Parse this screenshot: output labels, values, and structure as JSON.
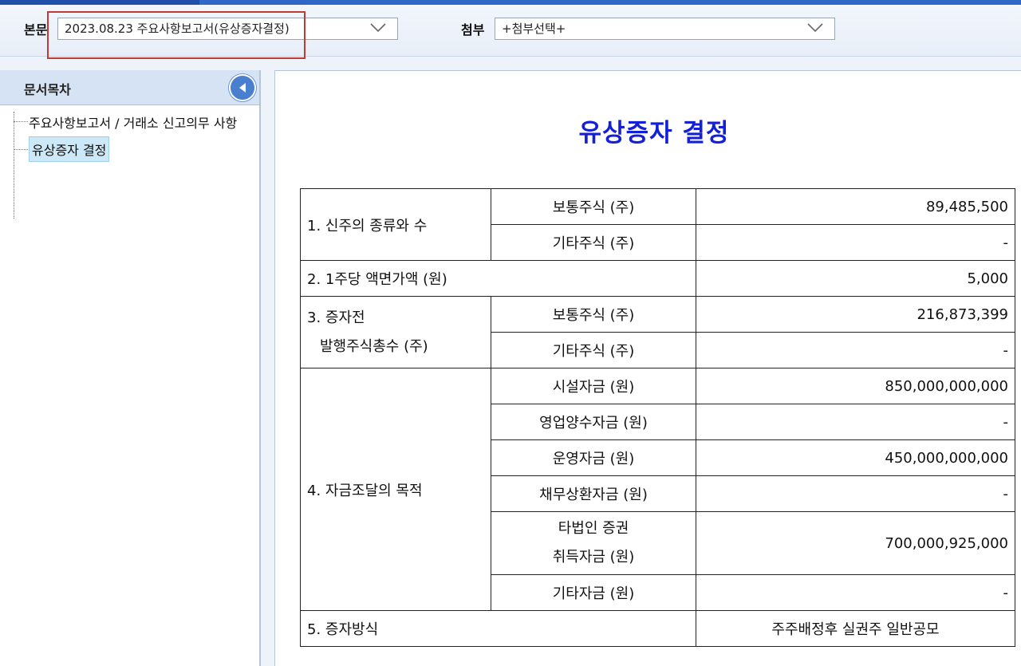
{
  "toolbar": {
    "body_label": "본문",
    "body_select_value": "2023.08.23  주요사항보고서(유상증자결정)",
    "attach_label": "첨부",
    "attach_select_value": "+첨부선택+"
  },
  "sidebar": {
    "title": "문서목차",
    "items": [
      {
        "label": "주요사항보고서 / 거래소 신고의무 사항"
      },
      {
        "label": "유상증자 결정"
      }
    ]
  },
  "document": {
    "title": "유상증자 결정",
    "rows": {
      "r1": {
        "label": "1. 신주의 종류와 수",
        "sub1": "보통주식 (주)",
        "val1": "89,485,500",
        "sub2": "기타주식 (주)",
        "val2": "-"
      },
      "r2": {
        "label": "2. 1주당 액면가액 (원)",
        "val": "5,000"
      },
      "r3": {
        "label_line1": "3. 증자전",
        "label_line2": "발행주식총수 (주)",
        "sub1": "보통주식 (주)",
        "val1": "216,873,399",
        "sub2": "기타주식 (주)",
        "val2": "-"
      },
      "r4": {
        "label": "4. 자금조달의 목적",
        "items": [
          {
            "name": "시설자금 (원)",
            "value": "850,000,000,000"
          },
          {
            "name": "영업양수자금 (원)",
            "value": "-"
          },
          {
            "name": "운영자금 (원)",
            "value": "450,000,000,000"
          },
          {
            "name": "채무상환자금 (원)",
            "value": "-"
          },
          {
            "name_line1": "타법인 증권",
            "name_line2": "취득자금 (원)",
            "value": "700,000,925,000"
          },
          {
            "name": "기타자금 (원)",
            "value": "-"
          }
        ]
      },
      "r5": {
        "label": "5. 증자방식",
        "val": "주주배정후 실권주 일반공모"
      }
    }
  }
}
